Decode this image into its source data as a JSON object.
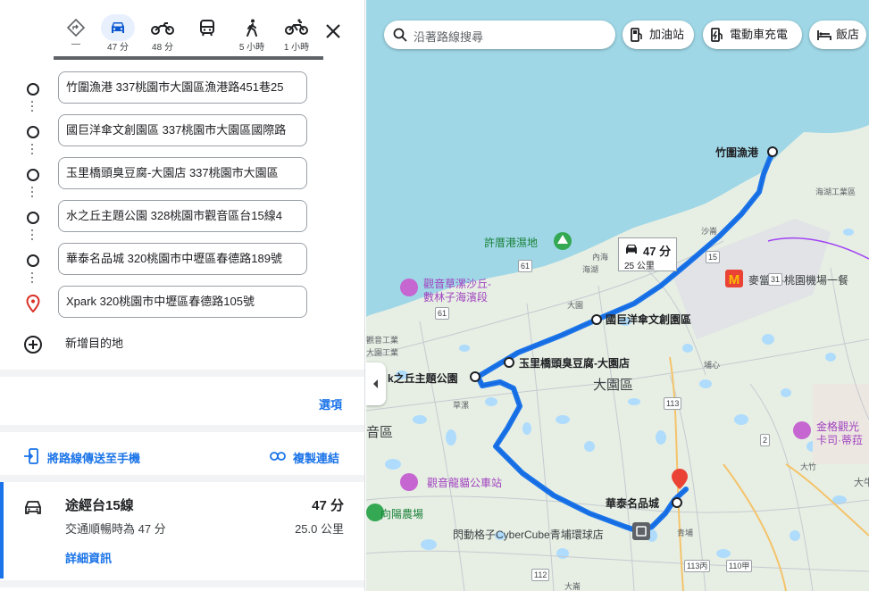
{
  "modes": [
    {
      "name": "best",
      "label": "—"
    },
    {
      "name": "car",
      "label": "47 分"
    },
    {
      "name": "motorcycle",
      "label": "48 分"
    },
    {
      "name": "transit",
      "label": ""
    },
    {
      "name": "walk",
      "label": "5 小時"
    },
    {
      "name": "bike",
      "label": "1 小時"
    }
  ],
  "stops": [
    "竹圍漁港 337桃園市大園區漁港路451巷25",
    "國巨洋傘文創園區 337桃園市大園區國際路",
    "玉里橋頭臭豆腐-大園店 337桃園市大園區",
    "水之丘主題公園 328桃園市觀音區台15線4",
    "華泰名品城 320桃園市中壢區春德路189號",
    "Xpark 320桃園市中壢區春德路105號"
  ],
  "add_destination": "新增目的地",
  "options_label": "選項",
  "send_to_phone": "將路線傳送至手機",
  "copy_link": "複製連結",
  "route": {
    "title": "途經台15線",
    "duration": "47 分",
    "subtitle": "交通順暢時為 47 分",
    "distance": "25.0 公里",
    "details": "詳細資訊"
  },
  "map": {
    "search_placeholder": "沿著路線搜尋",
    "chips": [
      "加油站",
      "電動車充電",
      "飯店"
    ],
    "callout_time": "47 分",
    "callout_dist": "25 公里",
    "places": {
      "zhuwei": "竹圍漁港",
      "guoju": "國巨洋傘文創園區",
      "yuli": "玉里橋頭臭豆腐-大園店",
      "shuizhiqiu": "k之丘主題公園",
      "huatai": "華泰名品城",
      "xpark_area": "閃動格子CyberCube青埔環球店",
      "mcd": "麥當勞-桃園機場一餐",
      "xuzuo": "許厝港濕地",
      "caoliao": "觀音草漯沙丘-",
      "caoliao2": "數林子海濱段",
      "dayuan": "大園區",
      "guanyin": "音區",
      "longmao": "觀音龍貓公車站",
      "xiangyang": "向陽農場",
      "jinge": "金格觀光",
      "jinge2": "卡司·蒂菈",
      "small": [
        "沙崙",
        "內海",
        "海湖",
        "大園工業",
        "草漯",
        "大園",
        "埔心",
        "大竹",
        "青埔",
        "大崙",
        "海湖工業區",
        "觀音工業",
        "大牛"
      ]
    },
    "roads": [
      "15",
      "61",
      "61",
      "113",
      "2",
      "112",
      "113丙",
      "110甲",
      "31"
    ]
  }
}
